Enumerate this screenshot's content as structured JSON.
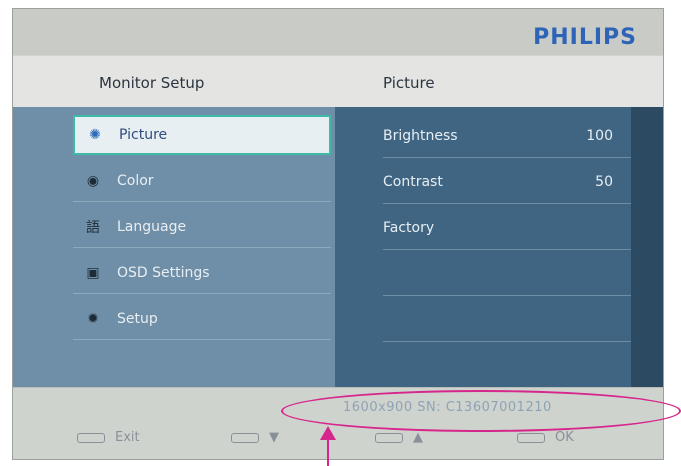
{
  "brand": "PHILIPS",
  "header": {
    "left_title": "Monitor Setup",
    "right_title": "Picture"
  },
  "menu": {
    "items": [
      {
        "icon": "sun-icon",
        "glyph": "✺",
        "label": "Picture",
        "active": true
      },
      {
        "icon": "color-wheel-icon",
        "glyph": "◉",
        "label": "Color",
        "active": false
      },
      {
        "icon": "language-icon",
        "glyph": "語",
        "label": "Language",
        "active": false
      },
      {
        "icon": "osd-settings-icon",
        "glyph": "▣",
        "label": "OSD Settings",
        "active": false
      },
      {
        "icon": "setup-gear-icon",
        "glyph": "✹",
        "label": "Setup",
        "active": false
      }
    ]
  },
  "submenu": {
    "items": [
      {
        "label": "Brightness",
        "value": "100"
      },
      {
        "label": "Contrast",
        "value": "50"
      },
      {
        "label": "Factory",
        "value": ""
      }
    ]
  },
  "footer": {
    "info_text": "1600x900 SN: C13607001210",
    "buttons": [
      {
        "label": "Exit"
      },
      {
        "label": "▼"
      },
      {
        "label": "▲"
      },
      {
        "label": "OK"
      }
    ]
  },
  "colors": {
    "annotation": "#d6268c",
    "brand": "#2e64b8",
    "highlight_border": "#3fb9a8"
  }
}
